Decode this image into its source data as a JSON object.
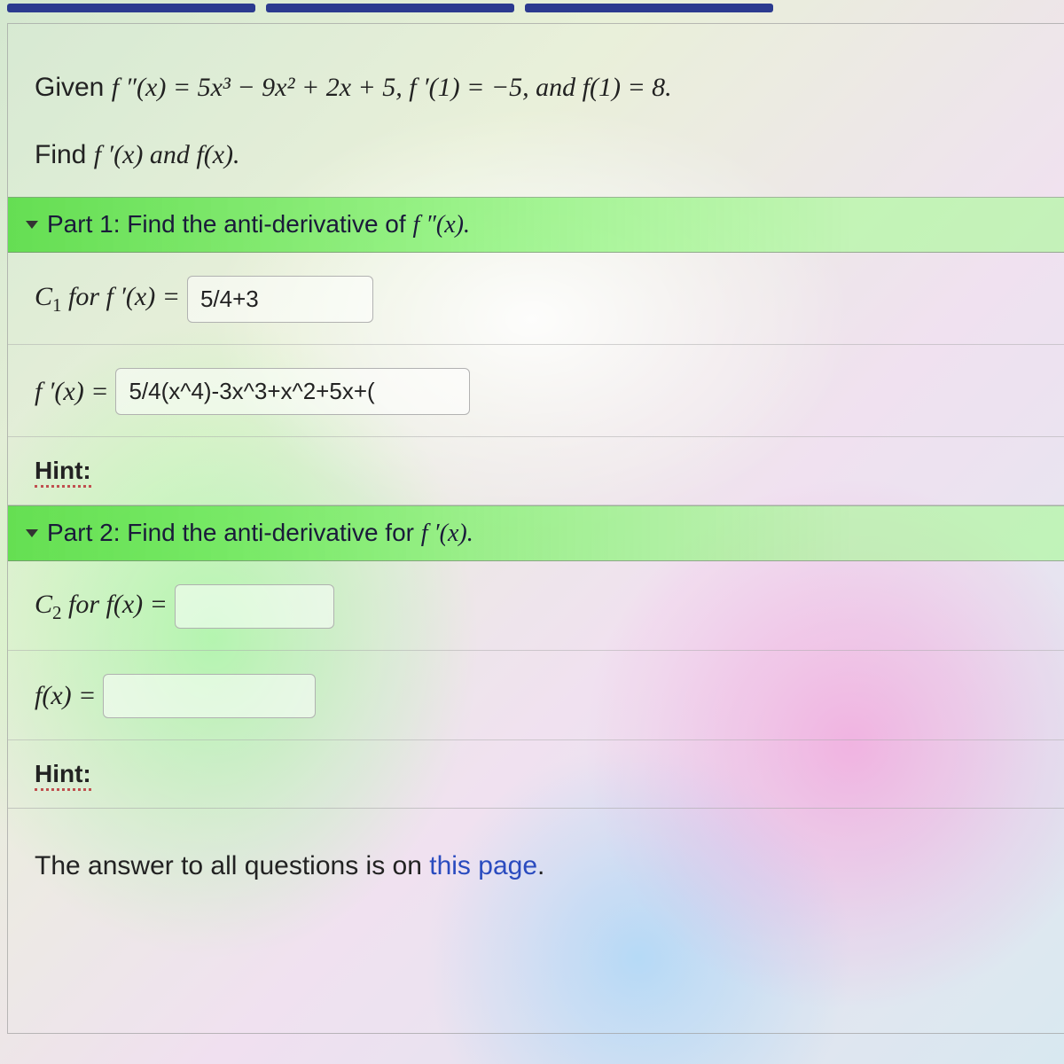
{
  "problem": {
    "given_prefix": "Given ",
    "given_math": "f ″(x) = 5x³ − 9x² + 2x + 5, f ′(1) = −5, and f(1) = 8.",
    "find_prefix": "Find ",
    "find_math": "f ′(x) and f(x)."
  },
  "part1": {
    "header_text": "Part 1: Find the anti-derivative of ",
    "header_math": "f ″(x).",
    "c1_label_pre": "C",
    "c1_label_sub": "1",
    "c1_label_post": " for f ′(x) = ",
    "c1_value": "5/4+3",
    "fprime_label": "f ′(x) = ",
    "fprime_value": "5/4(x^4)-3x^3+x^2+5x+(",
    "hint": "Hint:"
  },
  "part2": {
    "header_text": "Part 2: Find the anti-derivative for ",
    "header_math": "f ′(x).",
    "c2_label_pre": "C",
    "c2_label_sub": "2",
    "c2_label_post": " for f(x) = ",
    "c2_value": "",
    "fx_label": "f(x) = ",
    "fx_value": "",
    "hint": "Hint:"
  },
  "footer": {
    "text_pre": "The answer to all questions is on ",
    "link_text": "this page",
    "text_post": "."
  }
}
